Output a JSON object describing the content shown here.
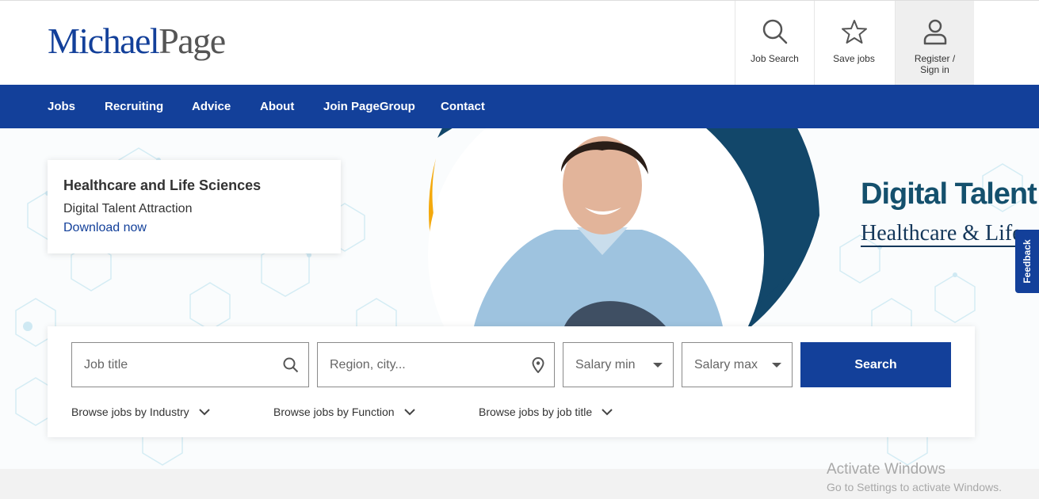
{
  "header": {
    "logo": {
      "part1": "Michael",
      "part2": "Page"
    },
    "buttons": {
      "job_search": "Job Search",
      "save_jobs": "Save jobs",
      "register_line1": "Register /",
      "register_line2": "Sign in"
    }
  },
  "nav": {
    "items": [
      "Jobs",
      "Recruiting",
      "Advice",
      "About",
      "Join PageGroup",
      "Contact"
    ]
  },
  "hero": {
    "promo": {
      "title": "Healthcare and Life Sciences",
      "subtitle": "Digital Talent Attraction",
      "link": "Download now"
    },
    "banner": {
      "title": "Digital Talent At",
      "subtitle": "Healthcare & Life"
    },
    "feedback": "Feedback"
  },
  "search": {
    "job_title_placeholder": "Job title",
    "location_placeholder": "Region, city...",
    "salary_min": "Salary min",
    "salary_max": "Salary max",
    "search_button": "Search",
    "browse": {
      "industry": "Browse jobs by Industry",
      "function": "Browse jobs by Function",
      "job_title": "Browse jobs by job title"
    }
  },
  "os_overlay": {
    "line1": "Activate Windows",
    "line2": "Go to Settings to activate Windows."
  },
  "colors": {
    "brand_blue": "#13409a",
    "banner_teal": "#14506d",
    "ring_navy": "#12476a",
    "ring_yellow": "#f4a90c"
  }
}
